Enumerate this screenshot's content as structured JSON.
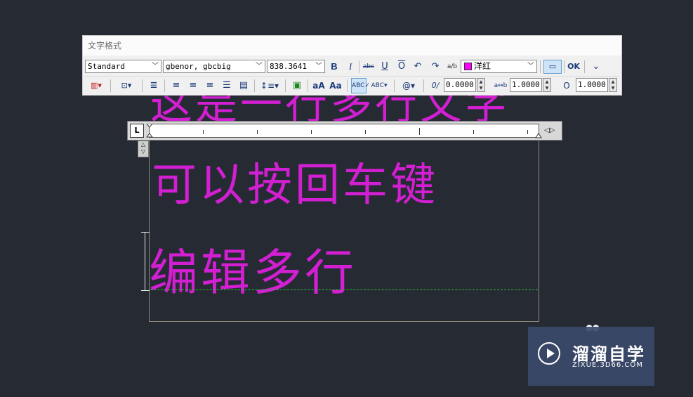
{
  "window": {
    "title": "文字格式"
  },
  "toolbar": {
    "style": {
      "value": "Standard"
    },
    "font": {
      "value": "gbenor, gbcbig"
    },
    "height": {
      "value": "838.3641"
    },
    "bold_label": "B",
    "italic_label": "I",
    "strike_label": "abc",
    "underline_label": "U",
    "overline_label": "O",
    "stack_label": "a/b",
    "color": {
      "value": "洋红",
      "swatch": "#ff00ff"
    },
    "ok_label": "OK",
    "oblique": {
      "value": "0.0000"
    },
    "tracking": {
      "value": "1.0000"
    },
    "width_factor": {
      "value": "1.0000"
    },
    "oblique_icon": "0/",
    "tracking_icon": "a↔b",
    "width_icon": "O"
  },
  "ruler": {
    "tab_label": "L"
  },
  "mtext": {
    "lines": [
      "这是一行多行文字",
      "可以按回车键",
      "编辑多行"
    ],
    "color": "#d21fd2"
  },
  "watermark": {
    "title": "溜溜自学",
    "url": "ZIXUE.3D66.COM"
  }
}
